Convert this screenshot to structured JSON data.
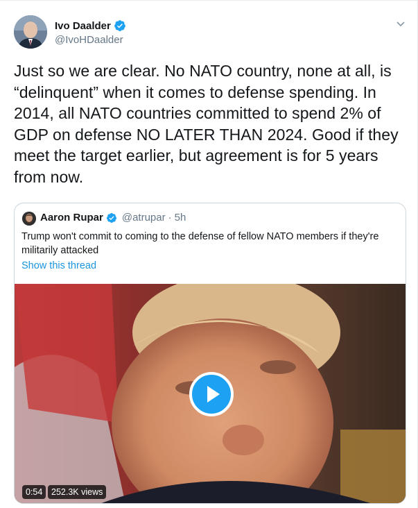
{
  "author": {
    "name": "Ivo Daalder",
    "handle": "@IvoHDaalder",
    "verified": true
  },
  "tweet": {
    "text": "Just so we are clear. No NATO country, none at all, is “delinquent” when it comes to defense spending. In 2014, all NATO countries committed to spend 2% of GDP on defense NO LATER THAN 2024. Good if they meet the target earlier, but agreement is for 5 years from now."
  },
  "quoted": {
    "name": "Aaron Rupar",
    "handle": "@atrupar",
    "separator": "·",
    "time": "5h",
    "verified": true,
    "text": "Trump won't commit to coming to the defense of fellow NATO members if they're militarily attacked",
    "link": "Show this thread",
    "video": {
      "duration": "0:54",
      "views": "252.3K views"
    }
  },
  "colors": {
    "accent": "#1da1f2",
    "link": "#1b95e0",
    "secondary_text": "#657786",
    "border": "#ccd6dd"
  },
  "icons": [
    "verified-badge-icon",
    "chevron-down-icon",
    "play-icon"
  ]
}
